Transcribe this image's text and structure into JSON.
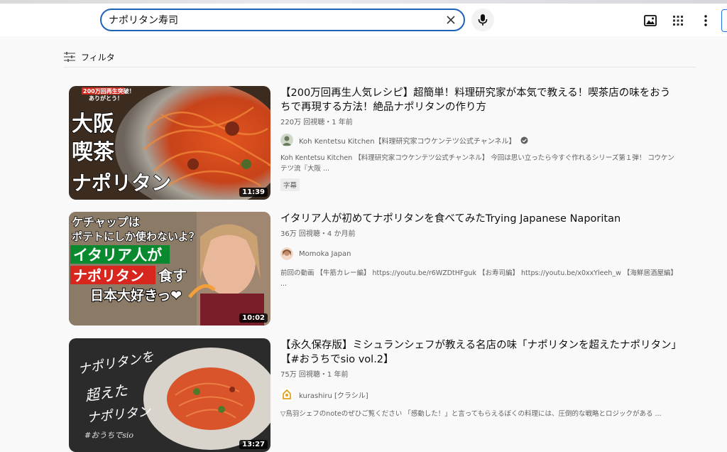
{
  "search": {
    "query": "ナポリタン寿司"
  },
  "filter": {
    "label": "フィルタ"
  },
  "results": [
    {
      "title": "【200万回再生人気レシピ】超簡単！料理研究家が本気で教える！喫茶店の味をおうちで再現する方法！絶品ナポリタンの作り方",
      "meta": "220万 回視聴・1 年前",
      "channel": "Koh Kentetsu Kitchen【料理研究家コウケンテツ公式チャンネル】",
      "description": "Koh Kentetsu Kitchen 【料理研究家コウケンテツ公式チャンネル】 今回は思い立ったら今すぐ作れるシリーズ第１弾！ コウケンテツ流『大阪 ...",
      "badge": "字幕",
      "duration": "11:39",
      "thumb_text": {
        "top": "200万回再生突破！",
        "top2": "ありがとう！",
        "line1": "大阪",
        "line2": "喫茶",
        "line3": "ナポリタン"
      }
    },
    {
      "title": "イタリア人が初めてナポリタンを食べてみたTrying Japanese Naporitan",
      "meta": "36万 回視聴・4 か月前",
      "channel": "Momoka Japan",
      "description": "前回の動画 【牛筋カレー編】 https://youtu.be/r6WZDtHFguk 【お寿司編】 https://youtu.be/x0xxYleeh_w 【海鮮居酒屋編】 ...",
      "duration": "10:02",
      "thumb_text": {
        "line1": "ケチャップは",
        "line2": "ポテトにしか使わないよ？",
        "line3": "イタリア人が",
        "line4": "ナポリタン",
        "line4b": "食す",
        "line5": "日本大好きっ❤"
      }
    },
    {
      "title": "【永久保存版】ミシュランシェフが教える名店の味「ナポリタンを超えたナポリタン」【#おうちでsio vol.2】",
      "meta": "75万 回視聴・1 年前",
      "channel": "kurashiru [クラシル]",
      "description": "▽鳥羽シェフのnoteのぜひご覧ください 「感動した！」と言ってもらえるぼくの料理には、圧倒的な戦略とロジックがある ...",
      "duration": "13:27",
      "thumb_text": {
        "line1": "ナポリタンを",
        "line2": "超えた",
        "line3": "ナポリタン",
        "line4": "#おうちでsio"
      }
    }
  ]
}
